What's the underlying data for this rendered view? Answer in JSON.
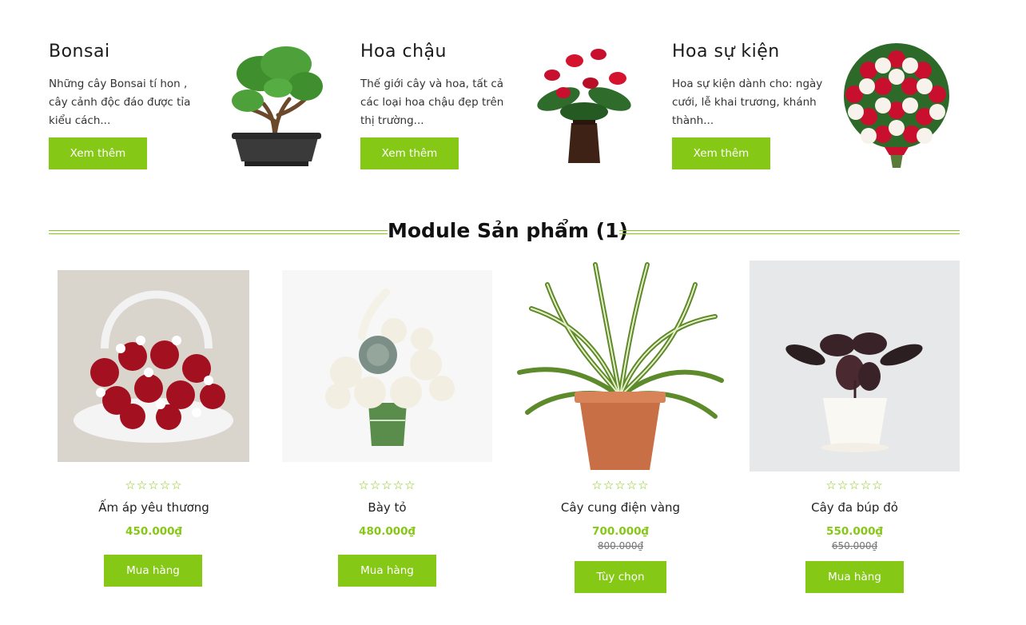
{
  "categories": [
    {
      "title": "Bonsai",
      "desc": "Những cây Bonsai tí hon , cây cảnh độc đáo được tỉa kiểu cách...",
      "button": "Xem thêm"
    },
    {
      "title": "Hoa chậu",
      "desc": "Thế giới cây và hoa, tất cả các loại hoa chậu đẹp trên thị trường...",
      "button": "Xem thêm"
    },
    {
      "title": "Hoa sự kiện",
      "desc": "Hoa sự kiện dành cho: ngày cưới, lễ khai trương, khánh thành...",
      "button": "Xem thêm"
    }
  ],
  "section": {
    "title": "Module Sản phẩm (1)"
  },
  "products": [
    {
      "name": "Ấm áp yêu thương",
      "price": "450.000₫",
      "old_price": "",
      "button": "Mua hàng",
      "stars": "☆☆☆☆☆"
    },
    {
      "name": "Bày tỏ",
      "price": "480.000₫",
      "old_price": "",
      "button": "Mua hàng",
      "stars": "☆☆☆☆☆"
    },
    {
      "name": "Cây cung điện vàng",
      "price": "700.000₫",
      "old_price": "800.000₫",
      "button": "Tùy chọn",
      "stars": "☆☆☆☆☆"
    },
    {
      "name": "Cây đa búp đỏ",
      "price": "550.000₫",
      "old_price": "650.000₫",
      "button": "Mua hàng",
      "stars": "☆☆☆☆☆"
    }
  ],
  "colors": {
    "accent": "#86c816",
    "text": "#222222"
  }
}
